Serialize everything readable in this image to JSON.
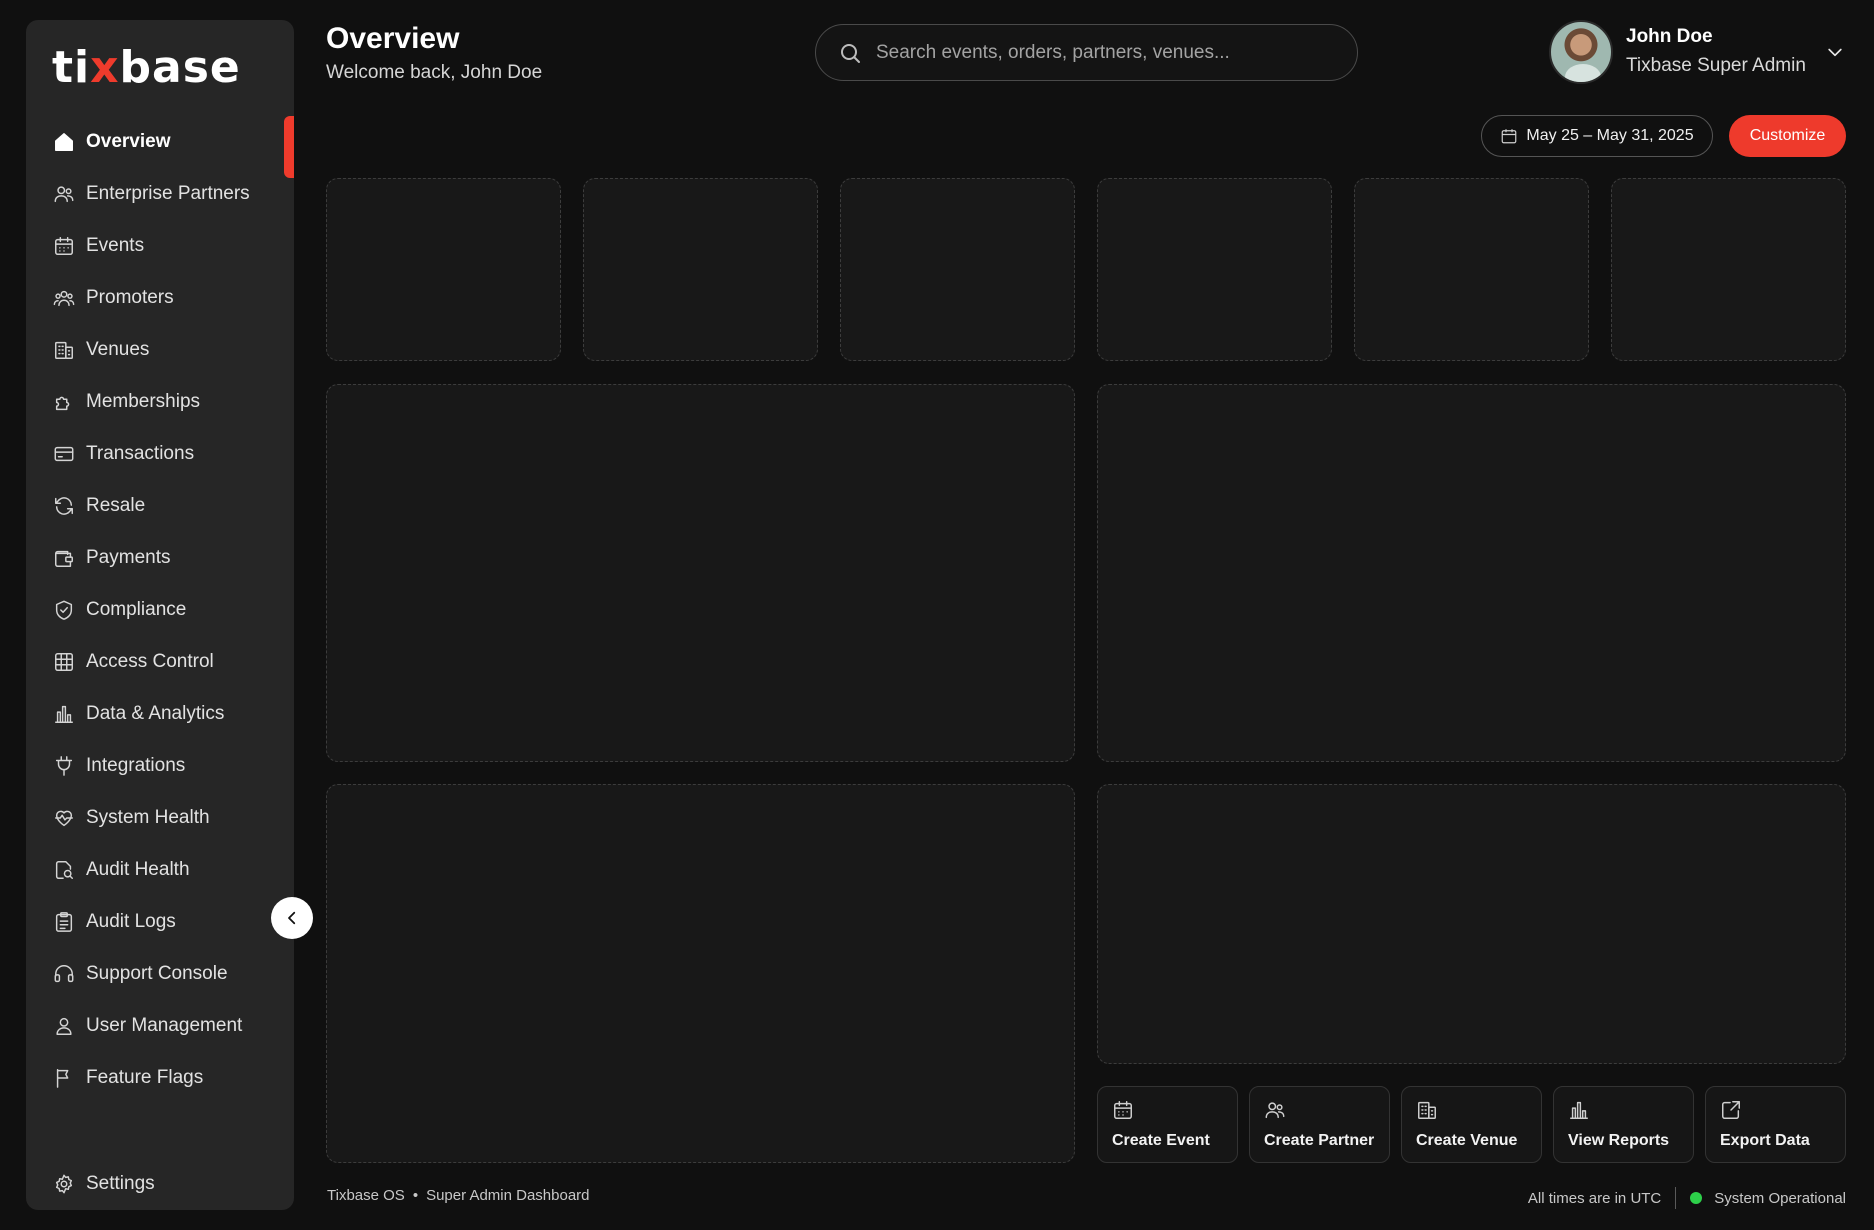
{
  "brand": {
    "logo_prefix": "ti",
    "logo_x": "x",
    "logo_suffix": "base",
    "accent": "#ef3b2c"
  },
  "header": {
    "title": "Overview",
    "subtitle": "Welcome back, John Doe",
    "search_placeholder": "Search events, orders, partners, venues...",
    "user_name": "John Doe",
    "user_role": "Tixbase Super Admin",
    "date_range": "May 25 – May 31, 2025",
    "customize_label": "Customize"
  },
  "sidebar": {
    "items": [
      {
        "label": "Overview",
        "icon": "home-icon",
        "active": true
      },
      {
        "label": "Enterprise Partners",
        "icon": "users-icon"
      },
      {
        "label": "Events",
        "icon": "calendar-icon"
      },
      {
        "label": "Promoters",
        "icon": "user-group-icon"
      },
      {
        "label": "Venues",
        "icon": "building-icon"
      },
      {
        "label": "Memberships",
        "icon": "puzzle-icon"
      },
      {
        "label": "Transactions",
        "icon": "card-icon"
      },
      {
        "label": "Resale",
        "icon": "refresh-icon"
      },
      {
        "label": "Payments",
        "icon": "wallet-icon"
      },
      {
        "label": "Compliance",
        "icon": "shield-check-icon"
      },
      {
        "label": "Access Control",
        "icon": "grid-globe-icon"
      },
      {
        "label": "Data & Analytics",
        "icon": "bar-chart-icon"
      },
      {
        "label": "Integrations",
        "icon": "plug-icon"
      },
      {
        "label": "System Health",
        "icon": "heart-pulse-icon"
      },
      {
        "label": "Audit Health",
        "icon": "search-doc-icon"
      },
      {
        "label": "Audit Logs",
        "icon": "clipboard-icon"
      },
      {
        "label": "Support Console",
        "icon": "headset-icon"
      },
      {
        "label": "User Management",
        "icon": "user-icon"
      },
      {
        "label": "Feature Flags",
        "icon": "flag-icon"
      }
    ],
    "settings_label": "Settings"
  },
  "quick_actions": [
    {
      "label": "Create Event",
      "icon": "calendar-icon"
    },
    {
      "label": "Create Partner",
      "icon": "users-icon"
    },
    {
      "label": "Create Venue",
      "icon": "building-icon"
    },
    {
      "label": "View Reports",
      "icon": "bar-chart-icon"
    },
    {
      "label": "Export Data",
      "icon": "export-icon"
    }
  ],
  "footer": {
    "product": "Tixbase OS",
    "dashboard": "Super Admin Dashboard",
    "timezone_note": "All times are in UTC",
    "status": "System Operational",
    "status_color": "#2dd04a"
  }
}
